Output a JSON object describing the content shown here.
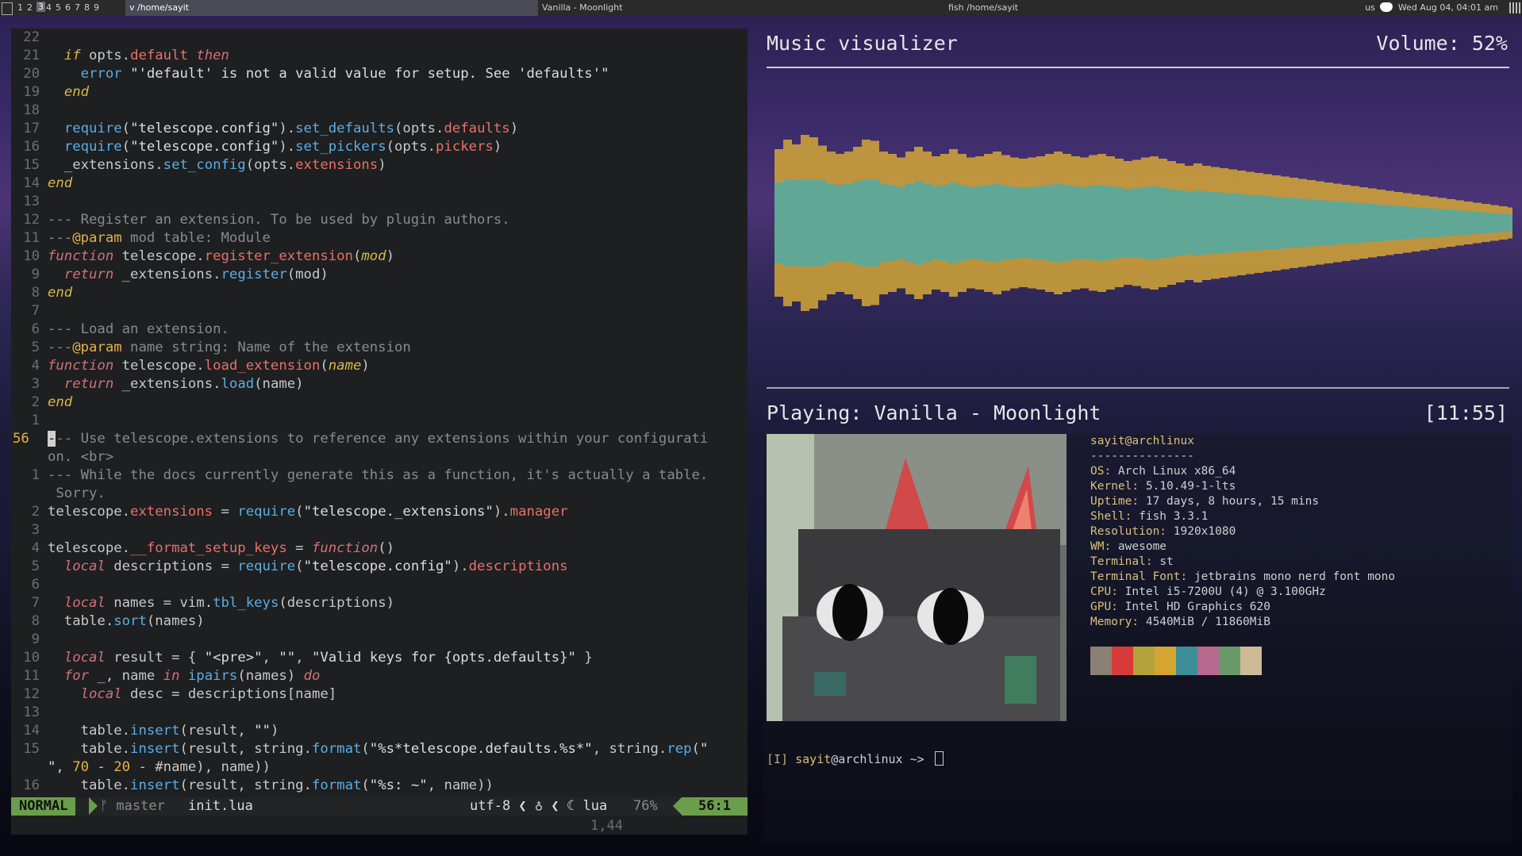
{
  "topbar": {
    "tags": [
      "1",
      "2",
      "3",
      "4",
      "5",
      "6",
      "7",
      "8",
      "9"
    ],
    "active_tag": "3",
    "tasks": [
      "v /home/sayit",
      "Vanilla - Moonlight",
      "fish /home/sayit"
    ],
    "keyboard_layout": "us",
    "clock": "Wed Aug 04, 04:01 am"
  },
  "editor": {
    "lines": [
      {
        "n": "22",
        "html": ""
      },
      {
        "n": "21",
        "html": "  <span class=\"kw2\">if</span> opts.<span class=\"field\">default</span> <span class=\"kw\">then</span>"
      },
      {
        "n": "20",
        "html": "    <span class=\"fn\">error</span> <span class=\"st\">\"'default' is not a valid value for setup. See 'defaults'\"</span>"
      },
      {
        "n": "19",
        "html": "  <span class=\"kw2\">end</span>"
      },
      {
        "n": "18",
        "html": ""
      },
      {
        "n": "17",
        "html": "  <span class=\"fn\">require</span>(<span class=\"st\">\"telescope.config\"</span>).<span class=\"fn\">set_defaults</span>(opts.<span class=\"field\">defaults</span>)"
      },
      {
        "n": "16",
        "html": "  <span class=\"fn\">require</span>(<span class=\"st\">\"telescope.config\"</span>).<span class=\"fn\">set_pickers</span>(opts.<span class=\"field\">pickers</span>)"
      },
      {
        "n": "15",
        "html": "  _extensions.<span class=\"fn\">set_config</span>(opts.<span class=\"field\">extensions</span>)"
      },
      {
        "n": "14",
        "html": "<span class=\"kw2\">end</span>"
      },
      {
        "n": "13",
        "html": ""
      },
      {
        "n": "12",
        "html": "<span class=\"cm\">--- Register an extension. To be used by plugin authors.</span>"
      },
      {
        "n": "11",
        "html": "<span class=\"cm\">---</span><span class=\"num\">@param</span><span class=\"cm\"> mod table: Module</span>"
      },
      {
        "n": "10",
        "html": "<span class=\"kw\">function</span> telescope.<span class=\"field\">register_extension</span>(<span class=\"kw2\">mod</span>)"
      },
      {
        "n": "9",
        "html": "  <span class=\"kw\">return</span> _extensions.<span class=\"fn\">register</span>(mod)"
      },
      {
        "n": "8",
        "html": "<span class=\"kw2\">end</span>"
      },
      {
        "n": "7",
        "html": ""
      },
      {
        "n": "6",
        "html": "<span class=\"cm\">--- Load an extension.</span>"
      },
      {
        "n": "5",
        "html": "<span class=\"cm\">---</span><span class=\"num\">@param</span><span class=\"cm\"> name string: Name of the extension</span>"
      },
      {
        "n": "4",
        "html": "<span class=\"kw\">function</span> telescope.<span class=\"field\">load_extension</span>(<span class=\"kw2\">name</span>)"
      },
      {
        "n": "3",
        "html": "  <span class=\"kw\">return</span> _extensions.<span class=\"fn\">load</span>(name)"
      },
      {
        "n": "2",
        "html": "<span class=\"kw2\">end</span>"
      },
      {
        "n": "1",
        "html": ""
      },
      {
        "n": "56",
        "cur": true,
        "html": "<span class=\"cursor\">-</span><span class=\"cm\">-- Use telescope.extensions to reference any extensions within your configurati</span>"
      },
      {
        "n": "",
        "html": "<span class=\"cm\">on. &lt;br&gt;</span>"
      },
      {
        "n": "1",
        "html": "<span class=\"cm\">--- While the docs currently generate this as a function, it's actually a table.</span>"
      },
      {
        "n": "",
        "html": "<span class=\"cm\"> Sorry.</span>"
      },
      {
        "n": "2",
        "html": "telescope.<span class=\"field\">extensions</span> = <span class=\"fn\">require</span>(<span class=\"st\">\"telescope._extensions\"</span>).<span class=\"field\">manager</span>"
      },
      {
        "n": "3",
        "html": ""
      },
      {
        "n": "4",
        "html": "telescope.<span class=\"field\">__format_setup_keys</span> = <span class=\"kw\">function</span>()"
      },
      {
        "n": "5",
        "html": "  <span class=\"kw\">local</span> descriptions = <span class=\"fn\">require</span>(<span class=\"st\">\"telescope.config\"</span>).<span class=\"field\">descriptions</span>"
      },
      {
        "n": "6",
        "html": ""
      },
      {
        "n": "7",
        "html": "  <span class=\"kw\">local</span> names = vim.<span class=\"fn\">tbl_keys</span>(descriptions)"
      },
      {
        "n": "8",
        "html": "  table.<span class=\"fn\">sort</span>(names)"
      },
      {
        "n": "9",
        "html": ""
      },
      {
        "n": "10",
        "html": "  <span class=\"kw\">local</span> result = { <span class=\"st\">\"&lt;pre&gt;\"</span>, <span class=\"st\">\"\"</span>, <span class=\"st\">\"Valid keys for {opts.defaults}\"</span> }"
      },
      {
        "n": "11",
        "html": "  <span class=\"kw\">for</span> _, name <span class=\"kw\">in</span> <span class=\"fn\">ipairs</span>(names) <span class=\"kw\">do</span>"
      },
      {
        "n": "12",
        "html": "    <span class=\"kw\">local</span> desc = descriptions[name]"
      },
      {
        "n": "13",
        "html": ""
      },
      {
        "n": "14",
        "html": "    table.<span class=\"fn\">insert</span>(result, <span class=\"st\">\"\"</span>)"
      },
      {
        "n": "15",
        "html": "    table.<span class=\"fn\">insert</span>(result, string.<span class=\"fn\">format</span>(<span class=\"st\">\"%s*telescope.defaults.%s*\"</span>, string.<span class=\"fn\">rep</span>(<span class=\"st\">\"</span>"
      },
      {
        "n": "",
        "html": "<span class=\"st\">\"</span>, <span class=\"num\">70</span> - <span class=\"num\">20</span> - #name), name))"
      },
      {
        "n": "16",
        "html": "    table.<span class=\"fn\">insert</span>(result, string.<span class=\"fn\">format</span>(<span class=\"st\">\"%s: ~\"</span>, name))"
      }
    ],
    "status": {
      "mode": "NORMAL",
      "branch": "ᚠ master",
      "file": "init.lua",
      "encoding": "utf-8 ❮ ♁ ❮",
      "filetype": "☾ lua",
      "percent": "76%",
      "position": "56:1"
    },
    "cmdline": "1,44"
  },
  "visualizer": {
    "title": "Music visualizer",
    "volume": "Volume: 52%",
    "playing": "Playing: Vanilla - Moonlight",
    "time": "[11:55]",
    "bar_levels": [
      0.62,
      0.7,
      0.66,
      0.74,
      0.72,
      0.65,
      0.6,
      0.58,
      0.6,
      0.64,
      0.7,
      0.69,
      0.6,
      0.58,
      0.55,
      0.6,
      0.64,
      0.6,
      0.56,
      0.58,
      0.62,
      0.58,
      0.55,
      0.56,
      0.58,
      0.6,
      0.57,
      0.55,
      0.54,
      0.55,
      0.56,
      0.58,
      0.6,
      0.58,
      0.56,
      0.55,
      0.57,
      0.58,
      0.56,
      0.54,
      0.52,
      0.53,
      0.55,
      0.56,
      0.54,
      0.52,
      0.5,
      0.48,
      0.5,
      0.48,
      0.47,
      0.46,
      0.45,
      0.44,
      0.43,
      0.42,
      0.41,
      0.4,
      0.39,
      0.38,
      0.37,
      0.36,
      0.35,
      0.34,
      0.33,
      0.32,
      0.31,
      0.3,
      0.29,
      0.28,
      0.27,
      0.26,
      0.25,
      0.24,
      0.23,
      0.22,
      0.21,
      0.2,
      0.19,
      0.18,
      0.17,
      0.16,
      0.15,
      0.14,
      0.13,
      0.12
    ]
  },
  "fetch": {
    "title": "sayit@archlinux",
    "separator": "---------------",
    "rows": [
      {
        "k": "OS",
        "v": "Arch Linux x86_64"
      },
      {
        "k": "Kernel",
        "v": "5.10.49-1-lts"
      },
      {
        "k": "Uptime",
        "v": "17 days, 8 hours, 15 mins"
      },
      {
        "k": "Shell",
        "v": "fish 3.3.1"
      },
      {
        "k": "Resolution",
        "v": "1920x1080"
      },
      {
        "k": "WM",
        "v": "awesome"
      },
      {
        "k": "Terminal",
        "v": "st"
      },
      {
        "k": "Terminal Font",
        "v": "jetbrains mono nerd font mono"
      },
      {
        "k": "CPU",
        "v": "Intel i5-7200U (4) @ 3.100GHz"
      },
      {
        "k": "GPU",
        "v": "Intel HD Graphics 620"
      },
      {
        "k": "Memory",
        "v": "4540MiB / 11860MiB"
      }
    ],
    "palette": [
      "#8a8174",
      "#d83a3a",
      "#b3a33a",
      "#d5a532",
      "#3e8e9a",
      "#b86a8e",
      "#6a9a6a",
      "#cdbb95"
    ]
  },
  "prompt": {
    "indicator": "[I]",
    "user": "sayit",
    "host": "@archlinux",
    "path": " ~>"
  }
}
